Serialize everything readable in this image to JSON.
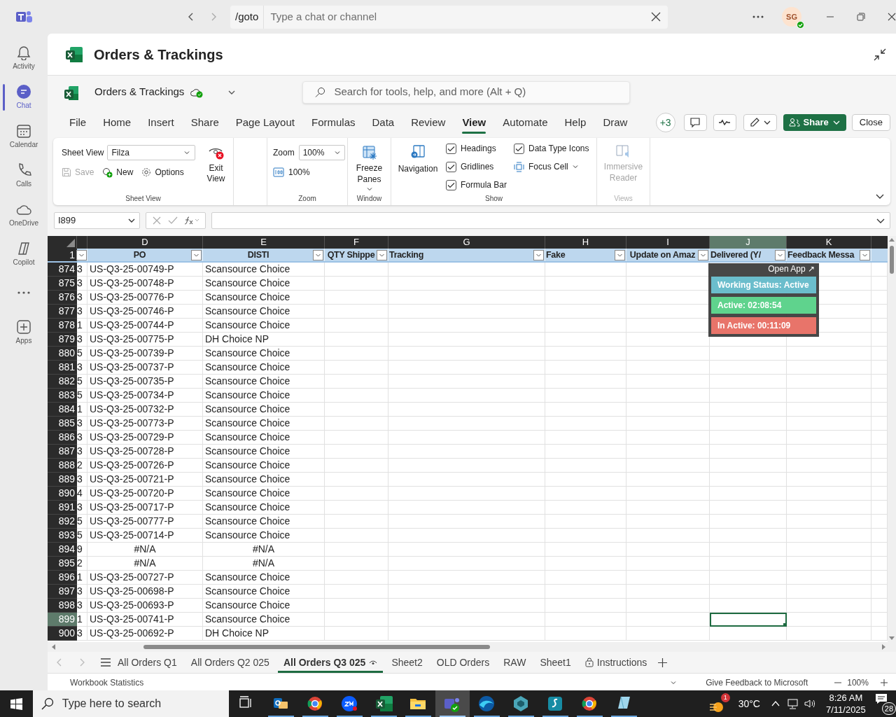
{
  "teams": {
    "command": "/goto",
    "search_placeholder": "Type a chat or channel",
    "avatar": "SG",
    "rail": [
      {
        "kind": "bell",
        "label": "Activity",
        "selected": false
      },
      {
        "kind": "chat",
        "label": "Chat",
        "selected": true
      },
      {
        "kind": "calendar",
        "label": "Calendar",
        "selected": false
      },
      {
        "kind": "phone",
        "label": "Calls",
        "selected": false
      },
      {
        "kind": "cloud",
        "label": "OneDrive",
        "selected": false
      },
      {
        "kind": "copilot",
        "label": "Copilot",
        "selected": false
      },
      {
        "kind": "more",
        "selected": false
      },
      {
        "kind": "apps",
        "label": "Apps",
        "selected": false
      }
    ]
  },
  "title": "Orders & Trackings",
  "app": {
    "doc_name": "Orders & Trackings",
    "search_placeholder": "Search for tools, help, and more (Alt + Q)"
  },
  "menu": [
    {
      "label": "File",
      "selected": false
    },
    {
      "label": "Home",
      "selected": false
    },
    {
      "label": "Insert",
      "selected": false
    },
    {
      "label": "Share",
      "selected": false
    },
    {
      "label": "Page Layout",
      "selected": false
    },
    {
      "label": "Formulas",
      "selected": false
    },
    {
      "label": "Data",
      "selected": false
    },
    {
      "label": "Review",
      "selected": false
    },
    {
      "label": "View",
      "selected": true
    },
    {
      "label": "Automate",
      "selected": false
    },
    {
      "label": "Help",
      "selected": false
    },
    {
      "label": "Draw",
      "selected": false
    }
  ],
  "toolbar": {
    "collaborators": "+3",
    "share": "Share",
    "close": "Close"
  },
  "ribbon": {
    "sheet_view": {
      "label": "Sheet View",
      "value": "Filza",
      "save": "Save",
      "save_disabled": true,
      "new": "New",
      "options": "Options",
      "exit": "Exit View",
      "group": "Sheet View"
    },
    "zoom": {
      "label": "Zoom",
      "value": "100%",
      "reset": "100%",
      "group": "Zoom"
    },
    "window": {
      "freeze": "Freeze Panes",
      "group": "Window"
    },
    "show": {
      "navigation": "Navigation",
      "checks": [
        {
          "label": "Headings",
          "checked": true
        },
        {
          "label": "Gridlines",
          "checked": true
        },
        {
          "label": "Formula Bar",
          "checked": true
        },
        {
          "label": "Data Type Icons",
          "checked": true
        }
      ],
      "focus": "Focus Cell",
      "group": "Show"
    },
    "views": {
      "immersive": "Immersive Reader",
      "disabled": true,
      "group": "Views"
    }
  },
  "formula_bar": {
    "name_box": "I899"
  },
  "sheet": {
    "columns": [
      {
        "letter": "D",
        "header": "PO",
        "selected": false
      },
      {
        "letter": "E",
        "header": "DISTI",
        "selected": false
      },
      {
        "letter": "F",
        "header": "QTY Shippe",
        "selected": false
      },
      {
        "letter": "G",
        "header": "Tracking",
        "selected": false
      },
      {
        "letter": "H",
        "header": "Fake",
        "selected": false
      },
      {
        "letter": "I",
        "header": "Update on Amaz",
        "selected": false
      },
      {
        "letter": "J",
        "header": "Delivered (Y/",
        "selected": true
      },
      {
        "letter": "K",
        "header": "Feedback Messa",
        "selected": false
      }
    ],
    "header_row": "1",
    "rows": [
      {
        "num": "874",
        "c": "3",
        "po": "US-Q3-25-00749-P",
        "disti": "Scansource Choice",
        "kind": "value",
        "selected": false
      },
      {
        "num": "875",
        "c": "3",
        "po": "US-Q3-25-00748-P",
        "disti": "Scansource Choice",
        "kind": "value",
        "selected": false
      },
      {
        "num": "876",
        "c": "3",
        "po": "US-Q3-25-00776-P",
        "disti": "Scansource Choice",
        "kind": "value",
        "selected": false
      },
      {
        "num": "877",
        "c": "3",
        "po": "US-Q3-25-00746-P",
        "disti": "Scansource Choice",
        "kind": "value",
        "selected": false
      },
      {
        "num": "878",
        "c": "1",
        "po": "US-Q3-25-00744-P",
        "disti": "Scansource Choice",
        "kind": "value",
        "selected": false
      },
      {
        "num": "879",
        "c": "3",
        "po": "US-Q3-25-00775-P",
        "disti": "DH Choice NP",
        "kind": "value",
        "selected": false
      },
      {
        "num": "880",
        "c": "5",
        "po": "US-Q3-25-00739-P",
        "disti": "Scansource Choice",
        "kind": "value",
        "selected": false
      },
      {
        "num": "881",
        "c": "3",
        "po": "US-Q3-25-00737-P",
        "disti": "Scansource Choice",
        "kind": "value",
        "selected": false
      },
      {
        "num": "882",
        "c": "5",
        "po": "US-Q3-25-00735-P",
        "disti": "Scansource Choice",
        "kind": "value",
        "selected": false
      },
      {
        "num": "883",
        "c": "5",
        "po": "US-Q3-25-00734-P",
        "disti": "Scansource Choice",
        "kind": "value",
        "selected": false
      },
      {
        "num": "884",
        "c": "1",
        "po": "US-Q3-25-00732-P",
        "disti": "Scansource Choice",
        "kind": "value",
        "selected": false
      },
      {
        "num": "885",
        "c": "3",
        "po": "US-Q3-25-00773-P",
        "disti": "Scansource Choice",
        "kind": "value",
        "selected": false
      },
      {
        "num": "886",
        "c": "3",
        "po": "US-Q3-25-00729-P",
        "disti": "Scansource Choice",
        "kind": "value",
        "selected": false
      },
      {
        "num": "887",
        "c": "3",
        "po": "US-Q3-25-00728-P",
        "disti": "Scansource Choice",
        "kind": "value",
        "selected": false
      },
      {
        "num": "888",
        "c": "2",
        "po": "US-Q3-25-00726-P",
        "disti": "Scansource Choice",
        "kind": "value",
        "selected": false
      },
      {
        "num": "889",
        "c": "3",
        "po": "US-Q3-25-00721-P",
        "disti": "Scansource Choice",
        "kind": "value",
        "selected": false
      },
      {
        "num": "890",
        "c": "4",
        "po": "US-Q3-25-00720-P",
        "disti": "Scansource Choice",
        "kind": "value",
        "selected": false
      },
      {
        "num": "891",
        "c": "3",
        "po": "US-Q3-25-00717-P",
        "disti": "Scansource Choice",
        "kind": "value",
        "selected": false
      },
      {
        "num": "892",
        "c": "5",
        "po": "US-Q3-25-00777-P",
        "disti": "Scansource Choice",
        "kind": "value",
        "selected": false
      },
      {
        "num": "893",
        "c": "5",
        "po": "US-Q3-25-00714-P",
        "disti": "Scansource Choice",
        "kind": "value",
        "selected": false
      },
      {
        "num": "894",
        "c": "9",
        "po": "#N/A",
        "disti": "#N/A",
        "kind": "error",
        "selected": false
      },
      {
        "num": "895",
        "c": "2",
        "po": "#N/A",
        "disti": "#N/A",
        "kind": "error",
        "selected": false
      },
      {
        "num": "896",
        "c": "1",
        "po": "US-Q3-25-00727-P",
        "disti": "Scansource Choice",
        "kind": "value",
        "selected": false
      },
      {
        "num": "897",
        "c": "3",
        "po": "US-Q3-25-00698-P",
        "disti": "Scansource Choice",
        "kind": "value",
        "selected": false
      },
      {
        "num": "898",
        "c": "3",
        "po": "US-Q3-25-00693-P",
        "disti": "Scansource Choice",
        "kind": "value",
        "selected": false
      },
      {
        "num": "899",
        "c": "1",
        "po": "US-Q3-25-00741-P",
        "disti": "Scansource Choice",
        "kind": "value",
        "selected": true
      },
      {
        "num": "900",
        "c": "3",
        "po": "US-Q3-25-00692-P",
        "disti": "DH Choice NP",
        "kind": "value",
        "selected": false
      }
    ]
  },
  "tracker": {
    "open_app": "Open App ↗",
    "items": [
      {
        "text": "Working Status: Active",
        "color": "#6bbdcc"
      },
      {
        "text": "Active: 02:08:54",
        "color": "#5fd38d"
      },
      {
        "text": "In Active: 00:11:09",
        "color": "#e8746a"
      }
    ]
  },
  "sheet_tabs": [
    {
      "label": "All Orders Q1",
      "kind": "plain",
      "selected": false
    },
    {
      "label": "All Orders Q2 025",
      "kind": "plain",
      "selected": false
    },
    {
      "label": "All Orders Q3 025",
      "kind": "viewed",
      "selected": true
    },
    {
      "label": "Sheet2",
      "kind": "plain",
      "selected": false
    },
    {
      "label": "OLD Orders",
      "kind": "plain",
      "selected": false
    },
    {
      "label": "RAW",
      "kind": "plain",
      "selected": false
    },
    {
      "label": "Sheet1",
      "kind": "plain",
      "selected": false
    },
    {
      "label": "Instructions",
      "kind": "locked",
      "selected": false
    }
  ],
  "status_bar": {
    "statistics": "Workbook Statistics",
    "feedback": "Give Feedback to Microsoft",
    "zoom": "100%"
  },
  "taskbar": {
    "search_placeholder": "Type here to search",
    "apps": [
      {
        "kind": "taskview",
        "selected": false
      },
      {
        "kind": "mail",
        "selected": false
      },
      {
        "kind": "browser",
        "selected": false
      },
      {
        "kind": "meeting",
        "selected": false
      },
      {
        "kind": "sheet",
        "selected": false
      },
      {
        "kind": "folder",
        "selected": false
      },
      {
        "kind": "chat",
        "selected": true
      },
      {
        "kind": "wave",
        "selected": false
      },
      {
        "kind": "gem",
        "selected": false
      },
      {
        "kind": "script",
        "selected": false
      },
      {
        "kind": "browser",
        "selected": false
      },
      {
        "kind": "notes",
        "selected": false
      }
    ],
    "weather_badge": "1",
    "temperature": "30°C",
    "time": "8:26 AM",
    "date": "7/11/2025",
    "notifications": "28"
  }
}
